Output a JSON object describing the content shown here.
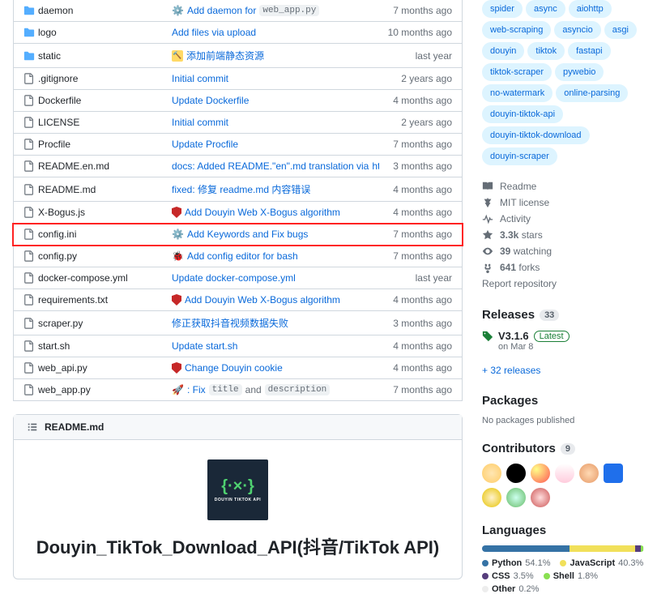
{
  "files": [
    {
      "name": "daemon",
      "type": "folder",
      "msg_pre": "",
      "icon": "gear",
      "msg": "Add daemon for",
      "code": "web_app.py",
      "time": "7 months ago",
      "hl": false
    },
    {
      "name": "logo",
      "type": "folder",
      "msg": "Add files via upload",
      "time": "10 months ago",
      "hl": false
    },
    {
      "name": "static",
      "type": "folder",
      "icon": "hammer",
      "msg": "添加前端静态资源",
      "time": "last year",
      "hl": false
    },
    {
      "name": ".gitignore",
      "type": "file",
      "msg": "Initial commit",
      "time": "2 years ago",
      "hl": false
    },
    {
      "name": "Dockerfile",
      "type": "file",
      "msg": "Update Dockerfile",
      "time": "4 months ago",
      "hl": false
    },
    {
      "name": "LICENSE",
      "type": "file",
      "msg": "Initial commit",
      "time": "2 years ago",
      "hl": false
    },
    {
      "name": "Procfile",
      "type": "file",
      "msg": "Update Procfile",
      "time": "7 months ago",
      "hl": false
    },
    {
      "name": "README.en.md",
      "type": "file",
      "msg": "docs: Added README.\"en\".md translation via",
      "link": "https://github.com/dephra…",
      "time": "3 months ago",
      "hl": false
    },
    {
      "name": "README.md",
      "type": "file",
      "msg": "fixed: 修复 readme.md 内容错误",
      "time": "4 months ago",
      "hl": false
    },
    {
      "name": "X-Bogus.js",
      "type": "file",
      "icon": "shield",
      "msg": "Add Douyin Web X-Bogus algorithm",
      "link_style": true,
      "time": "4 months ago",
      "hl": false
    },
    {
      "name": "config.ini",
      "type": "file",
      "icon": "gear",
      "msg": "Add Keywords and Fix bugs",
      "time": "7 months ago",
      "hl": true
    },
    {
      "name": "config.py",
      "type": "file",
      "icon": "bug",
      "msg": "Add config editor for bash",
      "link_style": true,
      "time": "7 months ago",
      "hl": false
    },
    {
      "name": "docker-compose.yml",
      "type": "file",
      "msg": "Update docker-compose.yml",
      "time": "last year",
      "hl": false
    },
    {
      "name": "requirements.txt",
      "type": "file",
      "icon": "shield",
      "msg": "Add Douyin Web X-Bogus algorithm",
      "link_style": true,
      "time": "4 months ago",
      "hl": false
    },
    {
      "name": "scraper.py",
      "type": "file",
      "msg": "修正获取抖音视频数据失败",
      "time": "3 months ago",
      "hl": false
    },
    {
      "name": "start.sh",
      "type": "file",
      "msg": "Update start.sh",
      "time": "4 months ago",
      "hl": false
    },
    {
      "name": "web_api.py",
      "type": "file",
      "icon": "shield",
      "msg": "Change Douyin cookie",
      "link_style": true,
      "time": "4 months ago",
      "hl": false
    },
    {
      "name": "web_app.py",
      "type": "file",
      "icon": "rocket",
      "msg": ": Fix",
      "code": "title",
      "msg2": "and",
      "code2": "description",
      "time": "7 months ago",
      "hl": false
    }
  ],
  "readme": {
    "filename": "README.md",
    "logo_brace": "{·×·}",
    "logo_text": "DOUYIN TIKTOK API",
    "title": "Douyin_TikTok_Download_API(抖音/TikTok API)"
  },
  "tags": [
    "spider",
    "async",
    "aiohttp",
    "web-scraping",
    "asyncio",
    "asgi",
    "douyin",
    "tiktok",
    "fastapi",
    "tiktok-scraper",
    "pywebio",
    "no-watermark",
    "online-parsing",
    "douyin-tiktok-api",
    "douyin-tiktok-download",
    "douyin-scraper"
  ],
  "stats": {
    "readme": "Readme",
    "license": "MIT license",
    "activity": "Activity",
    "stars_n": "3.3k",
    "stars_l": "stars",
    "watch_n": "39",
    "watch_l": "watching",
    "forks_n": "641",
    "forks_l": "forks",
    "report": "Report repository"
  },
  "releases": {
    "title": "Releases",
    "count": "33",
    "version": "V3.1.6",
    "latest": "Latest",
    "date": "on Mar 8",
    "more": "+ 32 releases"
  },
  "packages": {
    "title": "Packages",
    "none": "No packages published"
  },
  "contributors": {
    "title": "Contributors",
    "count": "9",
    "avatars": [
      {
        "bg": "radial-gradient(circle,#ffe6b3,#ffcc66)"
      },
      {
        "bg": "#000",
        "ring": "#000"
      },
      {
        "bg": "radial-gradient(circle at 30% 30%,#ff8,#f55)"
      },
      {
        "bg": "linear-gradient(#fff,#fcd)"
      },
      {
        "bg": "radial-gradient(circle,#ffd9b3,#e69966)"
      },
      {
        "bg": "#1f6feb",
        "square": true
      },
      {
        "bg": "radial-gradient(circle,#fff2cc,#e6c200)"
      },
      {
        "bg": "radial-gradient(circle,#cfe,#6b6)"
      },
      {
        "bg": "radial-gradient(circle,#fdd,#c55)"
      }
    ]
  },
  "languages": {
    "title": "Languages",
    "segments": [
      {
        "color": "#3572A5",
        "pct": 54.1
      },
      {
        "color": "#f1e05a",
        "pct": 40.3
      },
      {
        "color": "#563d7c",
        "pct": 3.5
      },
      {
        "color": "#89e051",
        "pct": 1.8
      },
      {
        "color": "#ededed",
        "pct": 0.2
      }
    ],
    "items": [
      {
        "name": "Python",
        "pct": "54.1%",
        "color": "#3572A5"
      },
      {
        "name": "JavaScript",
        "pct": "40.3%",
        "color": "#f1e05a"
      },
      {
        "name": "CSS",
        "pct": "3.5%",
        "color": "#563d7c"
      },
      {
        "name": "Shell",
        "pct": "1.8%",
        "color": "#89e051"
      },
      {
        "name": "Other",
        "pct": "0.2%",
        "color": "#ededed"
      }
    ]
  }
}
